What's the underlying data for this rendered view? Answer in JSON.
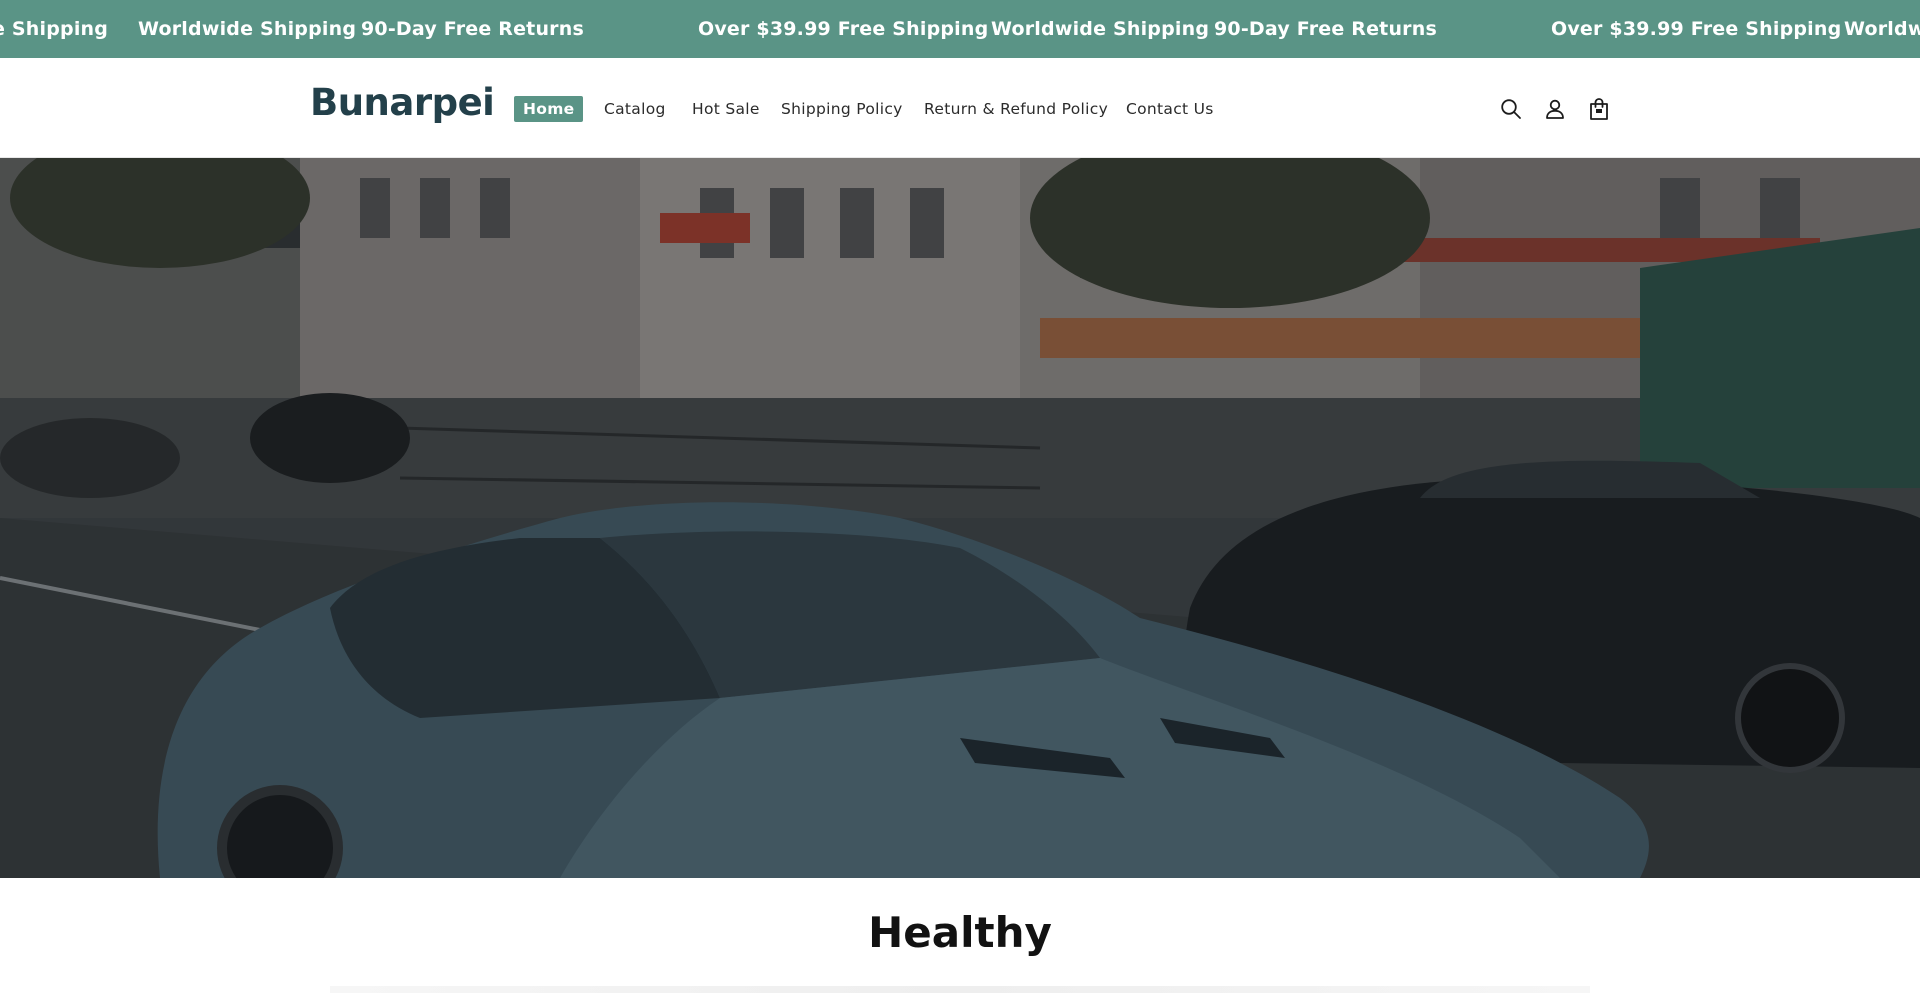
{
  "announcement": {
    "items": [
      "e Shipping",
      "Worldwide Shipping",
      "90-Day Free Returns",
      "Over $39.99 Free Shipping",
      "Worldwide Shipping",
      "90-Day Free Returns",
      "Over $39.99 Free Shipping",
      "Worldw"
    ],
    "background": "#5a9486",
    "text_color": "#ffffff"
  },
  "header": {
    "logo": "Bunarpei",
    "logo_color": "#23404a",
    "nav": [
      {
        "label": "Home",
        "active": true
      },
      {
        "label": "Catalog",
        "active": false
      },
      {
        "label": "Hot Sale",
        "active": false
      },
      {
        "label": "Shipping Policy",
        "active": false
      },
      {
        "label": "Return & Refund Policy",
        "active": false
      },
      {
        "label": "Contact Us",
        "active": false
      }
    ],
    "icons": [
      "search-icon",
      "account-icon",
      "cart-icon"
    ],
    "accent": "#5a9486"
  },
  "hero": {
    "image": "street-scene-with-classic-sports-car"
  },
  "section": {
    "title": "Healthy"
  }
}
